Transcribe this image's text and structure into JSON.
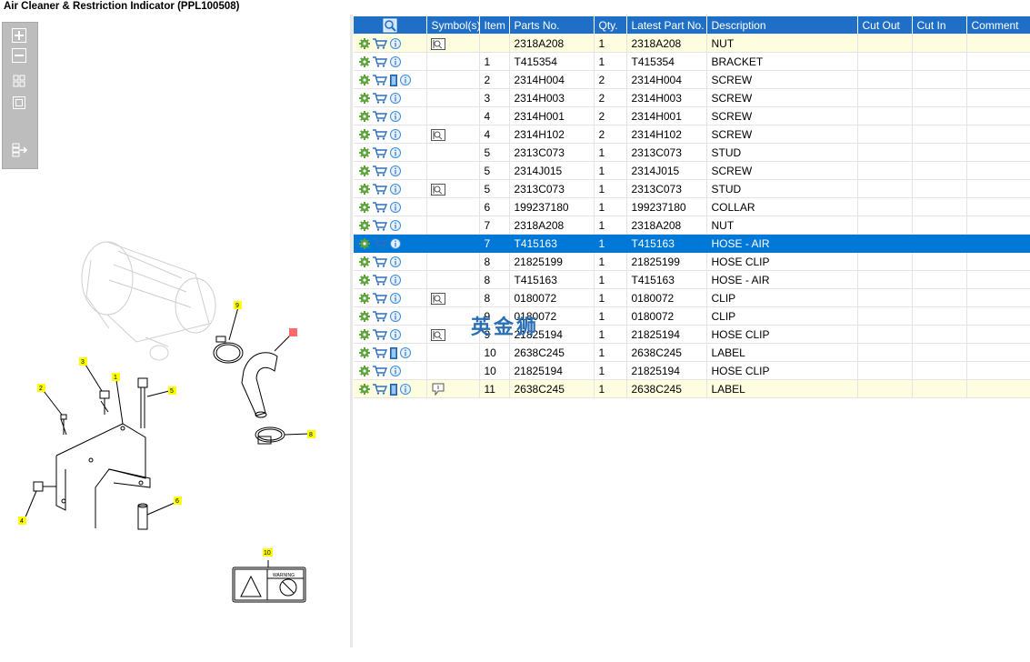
{
  "window": {
    "title": "Air Cleaner & Restriction Indicator (PPL100508)"
  },
  "toolbar": {
    "buttons": [
      "zoom-in",
      "zoom-out",
      "fit",
      "actual-size",
      "export"
    ]
  },
  "columns": [
    "",
    "Symbol(s)",
    "Item",
    "Parts No.",
    "Qty.",
    "Latest Part No.",
    "Description",
    "Cut Out",
    "Cut In",
    "Comment"
  ],
  "rows": [
    {
      "book": false,
      "info": true,
      "symbol": "book",
      "item": "",
      "part": "2318A208",
      "qty": "1",
      "latest": "2318A208",
      "desc": "NUT",
      "style": "yellow"
    },
    {
      "book": false,
      "info": true,
      "symbol": "",
      "item": "1",
      "part": "T415354",
      "qty": "1",
      "latest": "T415354",
      "desc": "BRACKET",
      "style": ""
    },
    {
      "book": true,
      "info": true,
      "symbol": "",
      "item": "2",
      "part": "2314H004",
      "qty": "2",
      "latest": "2314H004",
      "desc": "SCREW",
      "style": ""
    },
    {
      "book": false,
      "info": true,
      "symbol": "",
      "item": "3",
      "part": "2314H003",
      "qty": "2",
      "latest": "2314H003",
      "desc": "SCREW",
      "style": ""
    },
    {
      "book": false,
      "info": true,
      "symbol": "",
      "item": "4",
      "part": "2314H001",
      "qty": "2",
      "latest": "2314H001",
      "desc": "SCREW",
      "style": ""
    },
    {
      "book": false,
      "info": true,
      "symbol": "book",
      "item": "4",
      "part": "2314H102",
      "qty": "2",
      "latest": "2314H102",
      "desc": "SCREW",
      "style": ""
    },
    {
      "book": false,
      "info": true,
      "symbol": "",
      "item": "5",
      "part": "2313C073",
      "qty": "1",
      "latest": "2313C073",
      "desc": "STUD",
      "style": ""
    },
    {
      "book": false,
      "info": true,
      "symbol": "",
      "item": "5",
      "part": "2314J015",
      "qty": "1",
      "latest": "2314J015",
      "desc": "SCREW",
      "style": ""
    },
    {
      "book": false,
      "info": true,
      "symbol": "book",
      "item": "5",
      "part": "2313C073",
      "qty": "1",
      "latest": "2313C073",
      "desc": "STUD",
      "style": ""
    },
    {
      "book": false,
      "info": true,
      "symbol": "",
      "item": "6",
      "part": "199237180",
      "qty": "1",
      "latest": "199237180",
      "desc": "COLLAR",
      "style": ""
    },
    {
      "book": false,
      "info": true,
      "symbol": "",
      "item": "7",
      "part": "2318A208",
      "qty": "1",
      "latest": "2318A208",
      "desc": "NUT",
      "style": ""
    },
    {
      "book": false,
      "info": true,
      "symbol": "",
      "item": "7",
      "part": "T415163",
      "qty": "1",
      "latest": "T415163",
      "desc": "HOSE - AIR",
      "style": "selected"
    },
    {
      "book": false,
      "info": true,
      "symbol": "",
      "item": "8",
      "part": "21825199",
      "qty": "1",
      "latest": "21825199",
      "desc": "HOSE CLIP",
      "style": ""
    },
    {
      "book": false,
      "info": true,
      "symbol": "",
      "item": "8",
      "part": "T415163",
      "qty": "1",
      "latest": "T415163",
      "desc": "HOSE - AIR",
      "style": ""
    },
    {
      "book": false,
      "info": true,
      "symbol": "book",
      "item": "8",
      "part": "0180072",
      "qty": "1",
      "latest": "0180072",
      "desc": "CLIP",
      "style": ""
    },
    {
      "book": false,
      "info": true,
      "symbol": "",
      "item": "9",
      "part": "0180072",
      "qty": "1",
      "latest": "0180072",
      "desc": "CLIP",
      "style": ""
    },
    {
      "book": false,
      "info": true,
      "symbol": "book",
      "item": "9",
      "part": "21825194",
      "qty": "1",
      "latest": "21825194",
      "desc": "HOSE CLIP",
      "style": ""
    },
    {
      "book": true,
      "info": true,
      "symbol": "",
      "item": "10",
      "part": "2638C245",
      "qty": "1",
      "latest": "2638C245",
      "desc": "LABEL",
      "style": ""
    },
    {
      "book": false,
      "info": true,
      "symbol": "",
      "item": "10",
      "part": "21825194",
      "qty": "1",
      "latest": "21825194",
      "desc": "HOSE CLIP",
      "style": ""
    },
    {
      "book": true,
      "info": true,
      "symbol": "comment",
      "item": "11",
      "part": "2638C245",
      "qty": "1",
      "latest": "2638C245",
      "desc": "LABEL",
      "style": "yellow"
    }
  ],
  "diagram": {
    "callouts": [
      "9",
      "7",
      "3",
      "1",
      "5",
      "2",
      "8",
      "4",
      "6",
      "10"
    ],
    "label_warning": "WARNING"
  },
  "watermark": "英金狮",
  "colors": {
    "header": "#1f6fc6",
    "selected": "#0078d7",
    "highlight": "#fffde0",
    "gear": "#5ea33a",
    "cart": "#2e6fbf",
    "info": "#3d8bd8"
  }
}
